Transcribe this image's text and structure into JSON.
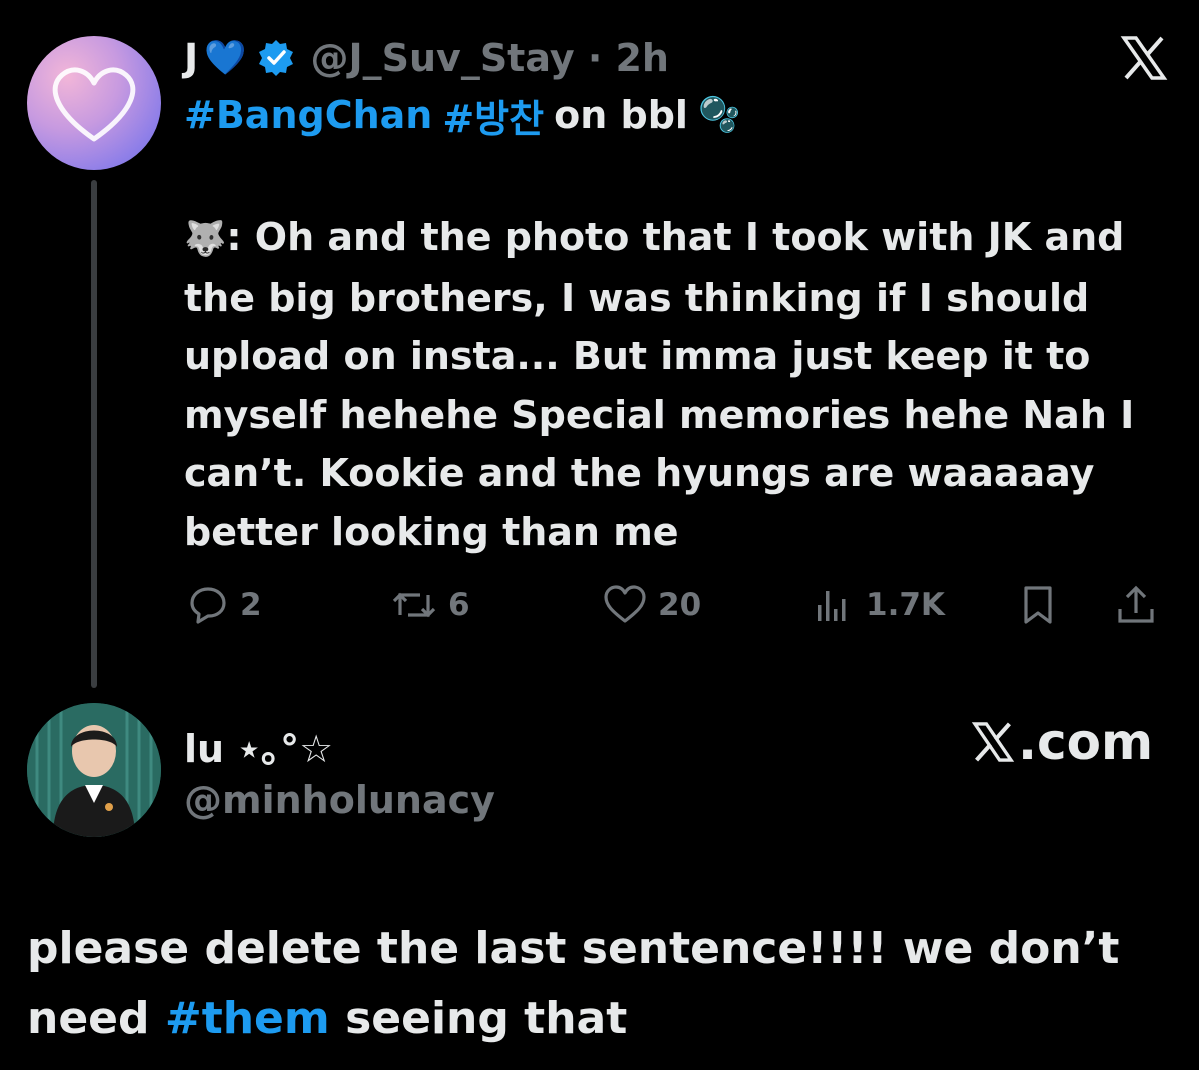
{
  "colors": {
    "background": "#000000",
    "text": "#e7e9ea",
    "muted": "#71767b",
    "link": "#1d9bf0",
    "verified": "#1d9bf0"
  },
  "tweet": {
    "display_name": "J",
    "name_emoji": "💙",
    "verified_icon": "verified-badge-icon",
    "handle_time": "@J_Suv_Stay · 2h",
    "hashtag_1": "#BangChan",
    "hashtag_2": "#방찬",
    "hashtag_suffix": "on bbl",
    "bubbles_emoji": "🫧",
    "wolf_emoji": "🐺",
    "body_text": ": Oh and the photo that I took with JK and the big brothers, I was thinking if I should upload on insta... But imma just keep it to myself hehehe Special memories hehe Nah I can’t. Kookie and the hyungs are waaaaay better looking than me",
    "actions": {
      "replies": "2",
      "reposts": "6",
      "likes": "20",
      "views": "1.7K"
    }
  },
  "quote_user": {
    "display_name": "lu ⋆｡°☆",
    "handle": "@minholunacy",
    "site_label": ".com"
  },
  "reply": {
    "text_1": "please delete the last sentence!!!! we don’t need ",
    "hashtag": "#them",
    "text_2": " seeing that"
  }
}
